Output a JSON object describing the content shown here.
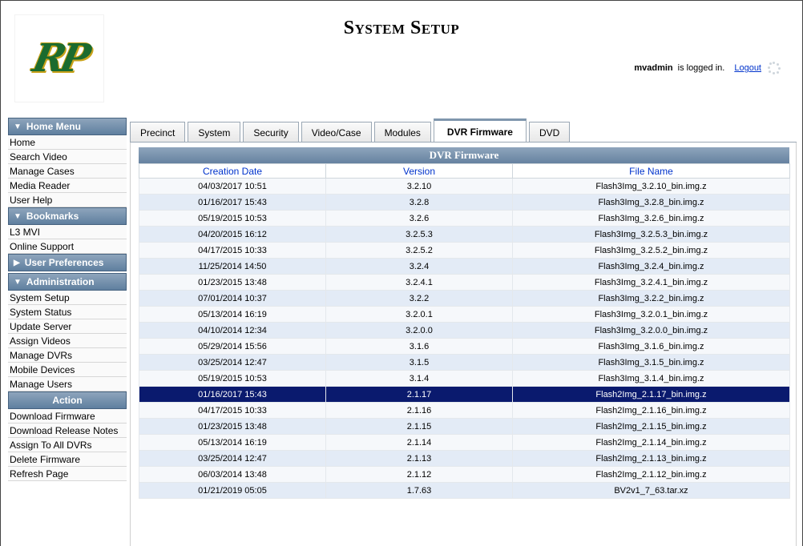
{
  "header": {
    "title": "System Setup",
    "logo_text": "RP",
    "user": "mvadmin",
    "logged_in_text": "is logged in.",
    "logout_label": "Logout"
  },
  "sidebar": {
    "home_menu": {
      "label": "Home Menu",
      "items": [
        "Home",
        "Search Video",
        "Manage Cases",
        "Media Reader",
        "User Help"
      ]
    },
    "bookmarks": {
      "label": "Bookmarks",
      "items": [
        "L3 MVI",
        "Online Support"
      ]
    },
    "user_preferences": {
      "label": "User Preferences"
    },
    "administration": {
      "label": "Administration",
      "items": [
        "System Setup",
        "System Status",
        "Update Server",
        "Assign Videos",
        "Manage DVRs",
        "Mobile Devices",
        "Manage Users"
      ]
    },
    "action": {
      "label": "Action",
      "items": [
        "Download Firmware",
        "Download Release Notes",
        "Assign To All DVRs",
        "Delete Firmware",
        "Refresh Page"
      ]
    }
  },
  "tabs": [
    "Precinct",
    "System",
    "Security",
    "Video/Case",
    "Modules",
    "DVR Firmware",
    "DVD"
  ],
  "active_tab": "DVR Firmware",
  "table": {
    "title": "DVR Firmware",
    "columns": [
      "Creation Date",
      "Version",
      "File Name"
    ],
    "selected_index": 13,
    "rows": [
      [
        "04/03/2017 10:51",
        "3.2.10",
        "Flash3Img_3.2.10_bin.img.z"
      ],
      [
        "01/16/2017 15:43",
        "3.2.8",
        "Flash3Img_3.2.8_bin.img.z"
      ],
      [
        "05/19/2015 10:53",
        "3.2.6",
        "Flash3Img_3.2.6_bin.img.z"
      ],
      [
        "04/20/2015 16:12",
        "3.2.5.3",
        "Flash3Img_3.2.5.3_bin.img.z"
      ],
      [
        "04/17/2015 10:33",
        "3.2.5.2",
        "Flash3Img_3.2.5.2_bin.img.z"
      ],
      [
        "11/25/2014 14:50",
        "3.2.4",
        "Flash3Img_3.2.4_bin.img.z"
      ],
      [
        "01/23/2015 13:48",
        "3.2.4.1",
        "Flash3Img_3.2.4.1_bin.img.z"
      ],
      [
        "07/01/2014 10:37",
        "3.2.2",
        "Flash3Img_3.2.2_bin.img.z"
      ],
      [
        "05/13/2014 16:19",
        "3.2.0.1",
        "Flash3Img_3.2.0.1_bin.img.z"
      ],
      [
        "04/10/2014 12:34",
        "3.2.0.0",
        "Flash3Img_3.2.0.0_bin.img.z"
      ],
      [
        "05/29/2014 15:56",
        "3.1.6",
        "Flash3Img_3.1.6_bin.img.z"
      ],
      [
        "03/25/2014 12:47",
        "3.1.5",
        "Flash3Img_3.1.5_bin.img.z"
      ],
      [
        "05/19/2015 10:53",
        "3.1.4",
        "Flash3Img_3.1.4_bin.img.z"
      ],
      [
        "01/16/2017 15:43",
        "2.1.17",
        "Flash2Img_2.1.17_bin.img.z"
      ],
      [
        "04/17/2015 10:33",
        "2.1.16",
        "Flash2Img_2.1.16_bin.img.z"
      ],
      [
        "01/23/2015 13:48",
        "2.1.15",
        "Flash2Img_2.1.15_bin.img.z"
      ],
      [
        "05/13/2014 16:19",
        "2.1.14",
        "Flash2Img_2.1.14_bin.img.z"
      ],
      [
        "03/25/2014 12:47",
        "2.1.13",
        "Flash2Img_2.1.13_bin.img.z"
      ],
      [
        "06/03/2014 13:48",
        "2.1.12",
        "Flash2Img_2.1.12_bin.img.z"
      ],
      [
        "01/21/2019 05:05",
        "1.7.63",
        "BV2v1_7_63.tar.xz"
      ]
    ]
  }
}
